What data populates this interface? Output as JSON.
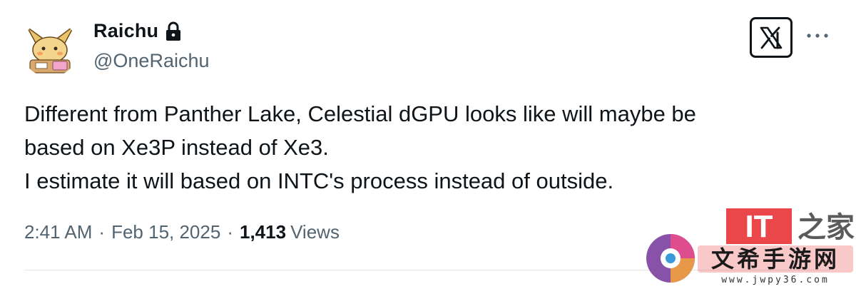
{
  "user": {
    "display_name": "Raichu",
    "handle": "@OneRaichu"
  },
  "tweet": {
    "lines": [
      "Different from Panther Lake, Celestial dGPU looks like will maybe be",
      "based on Xe3P instead of Xe3.",
      "I estimate it will based on INTC's process instead of outside."
    ],
    "time": "2:41 AM",
    "separator": "·",
    "date": "Feb 15, 2025",
    "views_count": "1,413",
    "views_label": "Views"
  },
  "watermark": {
    "logo_text": "IT",
    "chinese_text": "之家",
    "site_text": "www.jwpy36.com"
  },
  "icons": {
    "lock": "lock-icon",
    "x_logo": "x-logo-icon",
    "more": "more-dots-icon"
  },
  "colors": {
    "text_primary": "#0f1419",
    "text_secondary": "#536471",
    "divider": "#e7e7e7",
    "watermark_red": "#e8262a"
  }
}
